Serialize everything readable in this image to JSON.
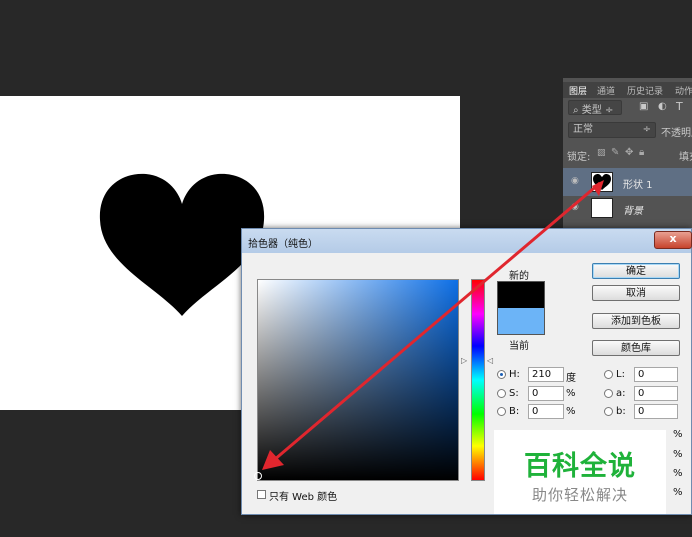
{
  "layers_panel": {
    "tabs": [
      "图层",
      "通道",
      "历史记录",
      "动作"
    ],
    "filter_kind": "类型",
    "blend_mode": "正常",
    "opacity_label": "不透明度",
    "lock_label": "锁定:",
    "fill_label": "填充",
    "layers": [
      {
        "name": "形状 1",
        "selected": true
      },
      {
        "name": "背景",
        "selected": false
      }
    ]
  },
  "dialog": {
    "title": "拾色器（纯色）",
    "close_symbol": "x",
    "new_label": "新的",
    "current_label": "当前",
    "new_color": "#000000",
    "current_color": "#6cb4f7",
    "buttons": {
      "ok": "确定",
      "cancel": "取消",
      "add_swatch": "添加到色板",
      "color_libraries": "颜色库"
    },
    "hsb": [
      {
        "key": "H:",
        "value": "210",
        "unit": "度",
        "selected": true
      },
      {
        "key": "S:",
        "value": "0",
        "unit": "%",
        "selected": false
      },
      {
        "key": "B:",
        "value": "0",
        "unit": "%",
        "selected": false
      }
    ],
    "lab": [
      {
        "key": "L:",
        "value": "0"
      },
      {
        "key": "a:",
        "value": "0"
      },
      {
        "key": "b:",
        "value": "0"
      }
    ],
    "percent_unit": "%",
    "web_only_label": "只有 Web 颜色"
  },
  "watermark": {
    "title": "百科全说",
    "subtitle": "助你轻松解决"
  },
  "colors": {
    "canvas_bg": "#282828",
    "heart": "#000000",
    "annotation_arrow": "#e0262e"
  }
}
